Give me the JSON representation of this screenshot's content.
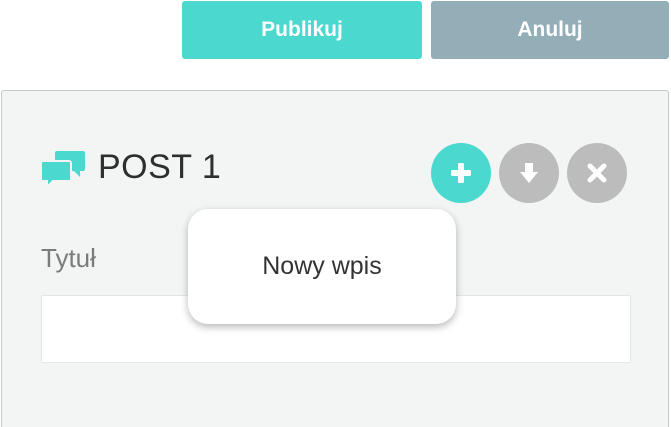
{
  "toolbar": {
    "publish_label": "Publikuj",
    "cancel_label": "Anuluj"
  },
  "post": {
    "title": "POST 1",
    "icon": "chat-bubbles-icon",
    "actions": [
      {
        "name": "add",
        "icon": "plus-icon"
      },
      {
        "name": "move-down",
        "icon": "arrow-down-icon"
      },
      {
        "name": "remove",
        "icon": "close-icon"
      }
    ],
    "field_label": "Tytuł",
    "title_value": "",
    "title_placeholder": ""
  },
  "tooltip": {
    "text": "Nowy wpis"
  },
  "colors": {
    "accent": "#4ad8cf",
    "cancel": "#93aeb6",
    "icon_inactive": "#bcbcbc",
    "panel_bg": "#f3f4f4"
  }
}
